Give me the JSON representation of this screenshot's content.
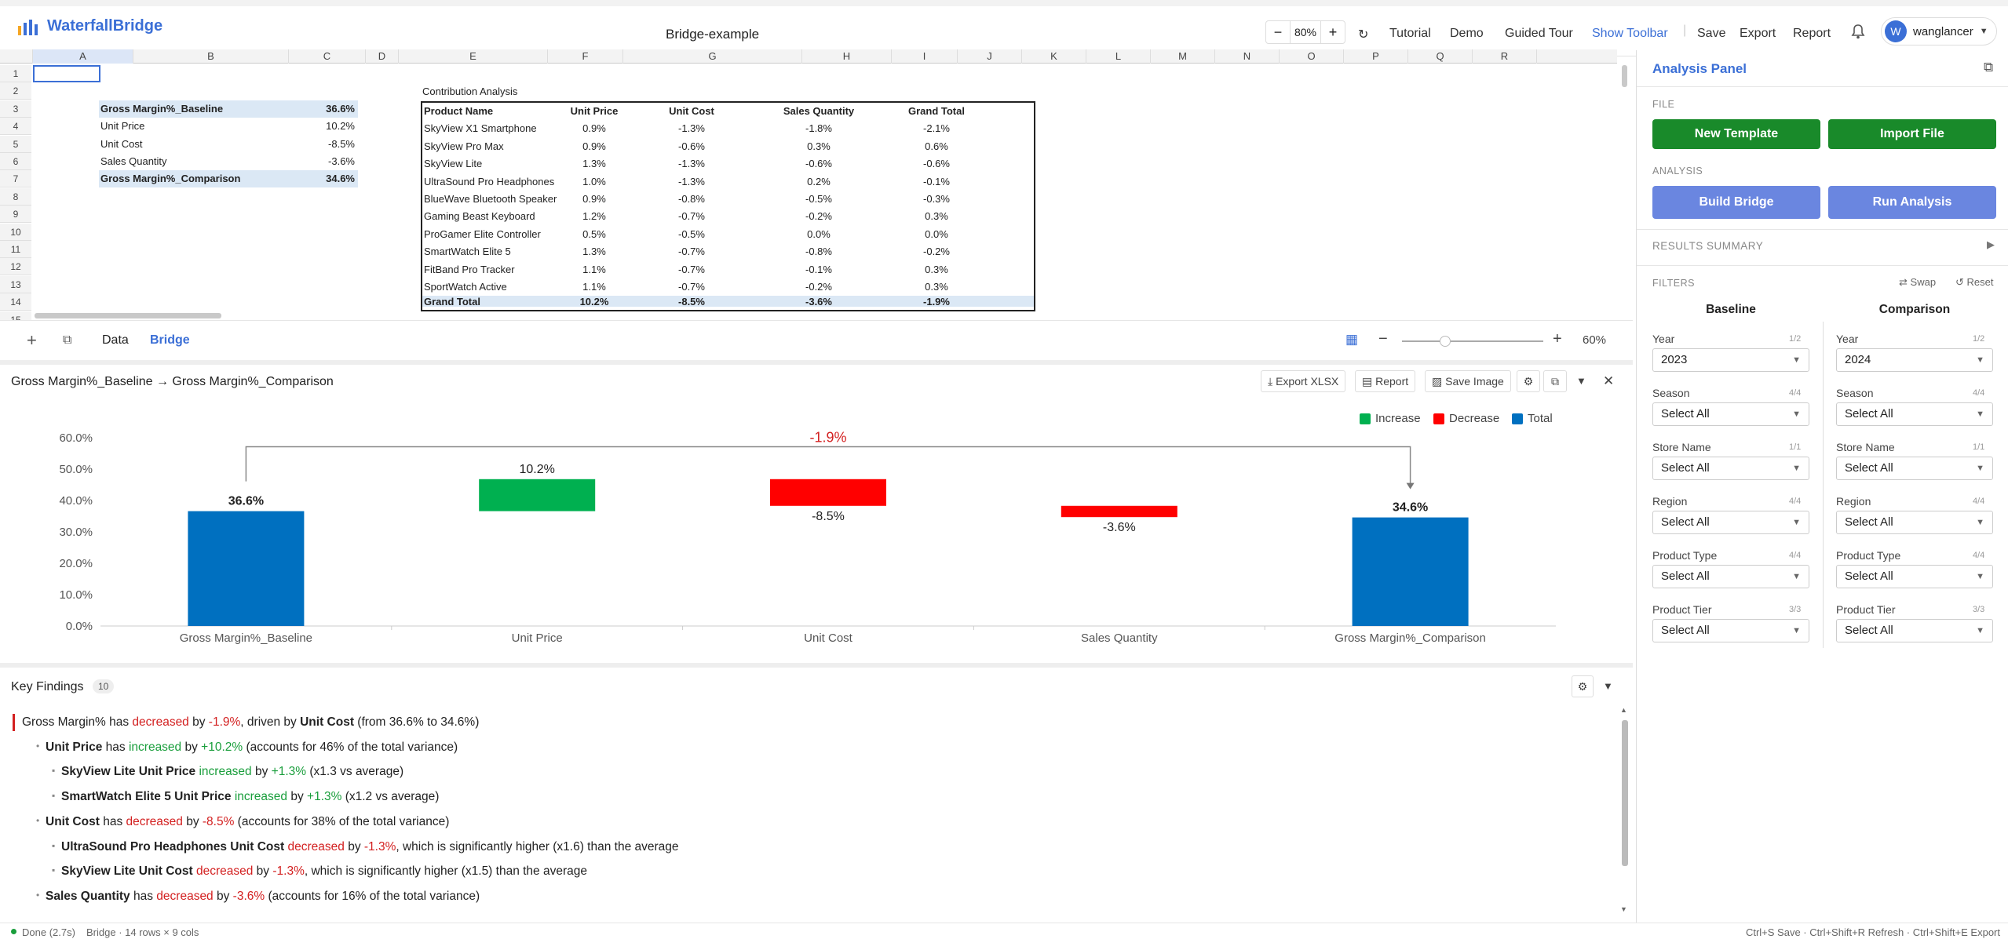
{
  "app": {
    "name": "WaterfallBridge",
    "doc_title": "Bridge-example"
  },
  "toolbar": {
    "zoom": "80%",
    "links": [
      "Tutorial",
      "Demo",
      "Guided Tour",
      "Show Toolbar",
      "Save",
      "Export",
      "Report"
    ],
    "user_initial": "W",
    "user_name": "wanglancer",
    "accent": "#3b6fd6"
  },
  "sheet": {
    "columns": [
      "A",
      "B",
      "C",
      "D",
      "E",
      "F",
      "G",
      "H",
      "I",
      "J",
      "K",
      "L",
      "M",
      "N",
      "O",
      "P",
      "Q",
      "R"
    ],
    "rows": [
      "1",
      "2",
      "3",
      "4",
      "5",
      "6",
      "7",
      "8",
      "9",
      "10",
      "11",
      "12",
      "13",
      "14",
      "15"
    ],
    "summary": [
      {
        "label": "Gross Margin%_Baseline",
        "value": "36.6%"
      },
      {
        "label": "Unit Price",
        "value": "10.2%"
      },
      {
        "label": "Unit Cost",
        "value": "-8.5%"
      },
      {
        "label": "Sales Quantity",
        "value": "-3.6%"
      },
      {
        "label": "Gross Margin%_Comparison",
        "value": "34.6%"
      }
    ],
    "table_title": "Contribution Analysis",
    "table_headers": [
      "Product Name",
      "Unit Price",
      "Unit Cost",
      "Sales Quantity",
      "Grand Total"
    ],
    "table_rows": [
      [
        "SkyView X1 Smartphone",
        "0.9%",
        "-1.3%",
        "-1.8%",
        "-2.1%"
      ],
      [
        "SkyView Pro Max",
        "0.9%",
        "-0.6%",
        "0.3%",
        "0.6%"
      ],
      [
        "SkyView Lite",
        "1.3%",
        "-1.3%",
        "-0.6%",
        "-0.6%"
      ],
      [
        "UltraSound Pro Headphones",
        "1.0%",
        "-1.3%",
        "0.2%",
        "-0.1%"
      ],
      [
        "BlueWave Bluetooth Speaker",
        "0.9%",
        "-0.8%",
        "-0.5%",
        "-0.3%"
      ],
      [
        "Gaming Beast Keyboard",
        "1.2%",
        "-0.7%",
        "-0.2%",
        "0.3%"
      ],
      [
        "ProGamer Elite Controller",
        "0.5%",
        "-0.5%",
        "0.0%",
        "0.0%"
      ],
      [
        "SmartWatch Elite 5",
        "1.3%",
        "-0.7%",
        "-0.8%",
        "-0.2%"
      ],
      [
        "FitBand Pro Tracker",
        "1.1%",
        "-0.7%",
        "-0.1%",
        "0.3%"
      ],
      [
        "SportWatch Active",
        "1.1%",
        "-0.7%",
        "-0.2%",
        "0.3%"
      ]
    ],
    "table_total": [
      "Grand Total",
      "10.2%",
      "-8.5%",
      "-3.6%",
      "-1.9%"
    ],
    "tabs": [
      "Data",
      "Bridge"
    ],
    "active_tab": "Bridge",
    "zoom": "60%"
  },
  "chart_panel": {
    "title": "Gross Margin%_Baseline → Gross Margin%_Comparison",
    "buttons": [
      "Export XLSX",
      "Report",
      "Save Image"
    ]
  },
  "chart_data": {
    "type": "bar",
    "subtype": "waterfall",
    "categories": [
      "Gross Margin%_Baseline",
      "Unit Price",
      "Unit Cost",
      "Sales Quantity",
      "Gross Margin%_Comparison"
    ],
    "values": [
      36.6,
      10.2,
      -8.5,
      -3.6,
      34.6
    ],
    "value_labels": [
      "36.6%",
      "10.2%",
      "-8.5%",
      "-3.6%",
      "34.6%"
    ],
    "kinds": [
      "total",
      "increase",
      "decrease",
      "decrease",
      "total"
    ],
    "legend": [
      "Increase",
      "Decrease",
      "Total"
    ],
    "legend_position": "top-right",
    "colors": {
      "increase": "#00b050",
      "decrease": "#ff0000",
      "total": "#0070c0"
    },
    "yticks": [
      "0.0%",
      "10.0%",
      "20.0%",
      "30.0%",
      "40.0%",
      "50.0%",
      "60.0%"
    ],
    "ylim": [
      0,
      60
    ],
    "bridge_label": "-1.9%"
  },
  "findings": {
    "title": "Key Findings",
    "count": "10",
    "lines": [
      {
        "parts": [
          [
            "Gross Margin% has ",
            ""
          ],
          [
            "decreased",
            "red"
          ],
          [
            " by ",
            ""
          ],
          [
            "-1.9%",
            "red"
          ],
          [
            ", driven by ",
            ""
          ],
          [
            "Unit Cost",
            "b"
          ],
          [
            " (from 36.6% to 34.6%)",
            ""
          ]
        ]
      },
      {
        "parts": [
          [
            "Unit Price",
            "b"
          ],
          [
            " has ",
            ""
          ],
          [
            "increased",
            "grn"
          ],
          [
            " by ",
            ""
          ],
          [
            "+10.2%",
            "grn"
          ],
          [
            " (accounts for 46% of the total variance)",
            ""
          ]
        ]
      },
      {
        "parts": [
          [
            "SkyView Lite Unit Price",
            "b"
          ],
          [
            " ",
            ""
          ],
          [
            "increased",
            "grn"
          ],
          [
            " by ",
            ""
          ],
          [
            "+1.3%",
            "grn"
          ],
          [
            " (x1.3 vs average)",
            ""
          ]
        ]
      },
      {
        "parts": [
          [
            "SmartWatch Elite 5 Unit Price",
            "b"
          ],
          [
            " ",
            ""
          ],
          [
            "increased",
            "grn"
          ],
          [
            " by ",
            ""
          ],
          [
            "+1.3%",
            "grn"
          ],
          [
            " (x1.2 vs average)",
            ""
          ]
        ]
      },
      {
        "parts": [
          [
            "Unit Cost",
            "b"
          ],
          [
            " has ",
            ""
          ],
          [
            "decreased",
            "red"
          ],
          [
            " by ",
            ""
          ],
          [
            "-8.5%",
            "red"
          ],
          [
            " (accounts for 38% of the total variance)",
            ""
          ]
        ]
      },
      {
        "parts": [
          [
            "UltraSound Pro Headphones Unit Cost",
            "b"
          ],
          [
            " ",
            ""
          ],
          [
            "decreased",
            "red"
          ],
          [
            " by ",
            ""
          ],
          [
            "-1.3%",
            "red"
          ],
          [
            ", which is significantly higher (x1.6) than the average",
            ""
          ]
        ]
      },
      {
        "parts": [
          [
            "SkyView Lite Unit Cost",
            "b"
          ],
          [
            " ",
            ""
          ],
          [
            "decreased",
            "red"
          ],
          [
            " by ",
            ""
          ],
          [
            "-1.3%",
            "red"
          ],
          [
            ", which is significantly higher (x1.5) than the average",
            ""
          ]
        ]
      },
      {
        "parts": [
          [
            "Sales Quantity",
            "b"
          ],
          [
            " has ",
            ""
          ],
          [
            "decreased",
            "red"
          ],
          [
            " by ",
            ""
          ],
          [
            "-3.6%",
            "red"
          ],
          [
            " (accounts for 16% of the total variance)",
            ""
          ]
        ]
      }
    ]
  },
  "status": {
    "left": "Done (2.7s)",
    "middle": "Bridge · 14 rows × 9 cols",
    "right": "Ctrl+S Save · Ctrl+Shift+R Refresh · Ctrl+Shift+E Export"
  },
  "panel": {
    "title": "Analysis Panel",
    "file_label": "FILE",
    "new_template": "New Template",
    "import_file": "Import File",
    "analysis_label": "ANALYSIS",
    "build_bridge": "Build Bridge",
    "run_analysis": "Run Analysis",
    "results_summary": "RESULTS SUMMARY",
    "filters_label": "FILTERS",
    "swap": "Swap",
    "reset": "Reset",
    "baseline": "Baseline",
    "comparison": "Comparison",
    "filters": [
      {
        "label": "Year",
        "count": "1/2",
        "baseline": "2023",
        "comparison": "2024"
      },
      {
        "label": "Season",
        "count": "4/4",
        "baseline": "Select All",
        "comparison": "Select All"
      },
      {
        "label": "Store Name",
        "count": "1/1",
        "baseline": "Select All",
        "comparison": "Select All"
      },
      {
        "label": "Region",
        "count": "4/4",
        "baseline": "Select All",
        "comparison": "Select All"
      },
      {
        "label": "Product Type",
        "count": "4/4",
        "baseline": "Select All",
        "comparison": "Select All"
      },
      {
        "label": "Product Tier",
        "count": "3/3",
        "baseline": "Select All",
        "comparison": "Select All"
      }
    ]
  }
}
